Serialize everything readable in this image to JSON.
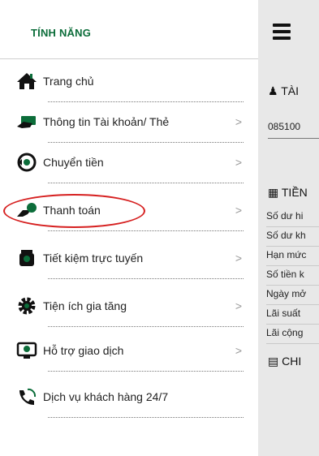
{
  "menu": {
    "title": "TÍNH NĂNG",
    "items": [
      {
        "label": "Trang chủ",
        "icon": "home-icon",
        "chevron": ""
      },
      {
        "label": "Thông tin Tài khoản/ Thẻ",
        "icon": "card-info-icon",
        "chevron": ">"
      },
      {
        "label": "Chuyển tiền",
        "icon": "money-transfer-icon",
        "chevron": ">"
      },
      {
        "label": "Thanh toán",
        "icon": "payment-hand-icon",
        "chevron": ">"
      },
      {
        "label": "Tiết kiệm trực tuyến",
        "icon": "piggy-bank-icon",
        "chevron": ">"
      },
      {
        "label": "Tiện ích gia tăng",
        "icon": "gear-icon",
        "chevron": ">"
      },
      {
        "label": "Hỗ trợ giao dịch",
        "icon": "support-screen-icon",
        "chevron": ">"
      },
      {
        "label": "Dịch vụ khách hàng 24/7",
        "icon": "phone-support-icon",
        "chevron": ""
      }
    ]
  },
  "main": {
    "account_section": "TÀI",
    "account_number": "085100",
    "money_section": "TIỀN",
    "rows": [
      "Số dư hi",
      "Số dư kh",
      "Hạn mức",
      "Số tiền k",
      "Ngày mở",
      "Lãi suất",
      "Lãi cộng"
    ],
    "detail_section": "CHI"
  },
  "colors": {
    "accent_green": "#0c6d3a",
    "highlight_red": "#d62020",
    "overlay_gray": "#e8e8e8"
  }
}
